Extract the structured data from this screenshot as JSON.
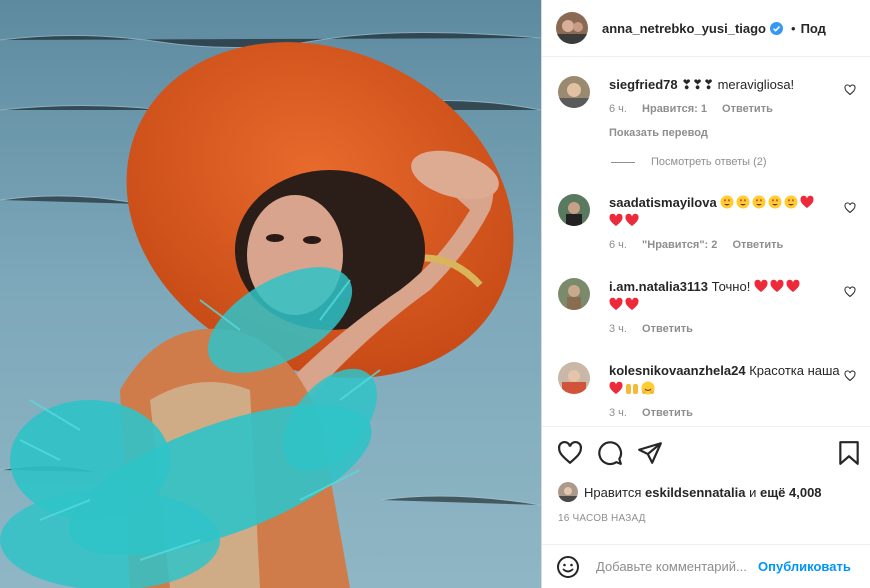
{
  "post": {
    "username": "anna_netrebko_yusi_tiago",
    "dot": "•",
    "follow": "Под"
  },
  "comments": [
    {
      "user": "siegfried78",
      "text": "❣❣❣ meravigliosa!",
      "time": "6 ч.",
      "likes": "Нравится: 1",
      "reply": "Ответить",
      "translate": "Показать перевод"
    },
    {
      "user": "saadatismayilova",
      "text": "",
      "time": "6 ч.",
      "likes": "\"Нравится\": 2",
      "reply": "Ответить"
    },
    {
      "user": "i.am.natalia3113",
      "text": "Точно!",
      "time": "3 ч.",
      "reply": "Ответить"
    },
    {
      "user": "kolesnikovaanzhela24",
      "text": "Красотка наша",
      "time": "3 ч.",
      "reply": "Ответить"
    }
  ],
  "view_replies": "Посмотреть ответы (2)",
  "likes": {
    "prefix": "Нравится",
    "user": "eskildsennatalia",
    "and": "и",
    "more": "ещё 4,008"
  },
  "timestamp": "16 ЧАСОВ НАЗАД",
  "add_comment": {
    "placeholder": "Добавьте комментарий...",
    "post_label": "Опубликовать"
  },
  "colors": {
    "accent": "#0095f6",
    "verified": "#3897f0",
    "heart_red": "#ed4956"
  }
}
